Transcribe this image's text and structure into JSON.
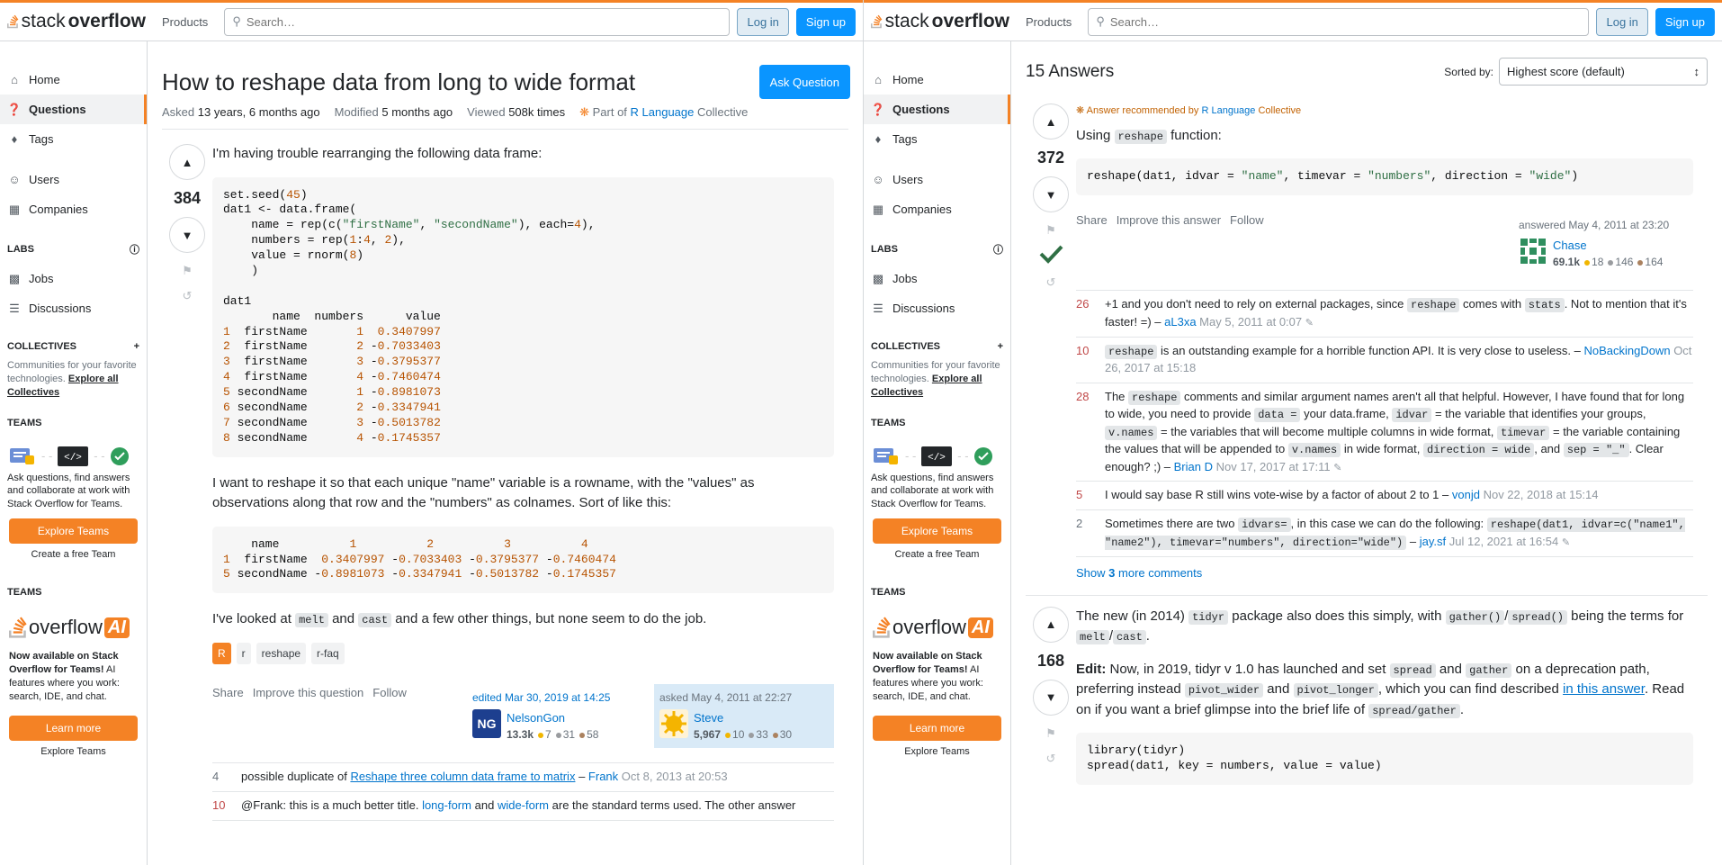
{
  "header": {
    "logo_text": [
      "stack",
      "overflow"
    ],
    "products": "Products",
    "search_placeholder": "Search…",
    "login": "Log in",
    "signup": "Sign up"
  },
  "nav": {
    "home": "Home",
    "questions": "Questions",
    "tags": "Tags",
    "users": "Users",
    "companies": "Companies",
    "labs": "LABS",
    "jobs": "Jobs",
    "discussions": "Discussions",
    "collectives": "COLLECTIVES",
    "collectives_text": "Communities for your favorite technologies.",
    "explore_all": "Explore all Collectives",
    "teams": "TEAMS",
    "teams_text": "Ask questions, find answers and collaborate at work with Stack Overflow for Teams.",
    "explore_teams": "Explore Teams",
    "create_team": "Create a free Team",
    "teams2": "TEAMS",
    "overflow_word": "overflow",
    "ai_badge": "AI",
    "oai_bold": "Now available on Stack Overflow for Teams!",
    "oai_text": " AI features where you work: search, IDE, and chat.",
    "learn_more": "Learn more",
    "explore_teams2": "Explore Teams"
  },
  "question": {
    "title": "How to reshape data from long to wide format",
    "ask_button": "Ask Question",
    "asked_label": "Asked",
    "asked_value": "13 years, 6 months ago",
    "modified_label": "Modified",
    "modified_value": "5 months ago",
    "viewed_label": "Viewed",
    "viewed_value": "508k times",
    "collective_prefix": "Part of",
    "collective_name": "R Language",
    "collective_suffix": "Collective",
    "score": "384",
    "p1": "I'm having trouble rearranging the following data frame:",
    "p2": "I want to reshape it so that each unique \"name\" variable is a rowname, with the \"values\" as observations along that row and the \"numbers\" as colnames. Sort of like this:",
    "p3a": "I've looked at",
    "p3_code1": "melt",
    "p3b": "and",
    "p3_code2": "cast",
    "p3c": "and a few other things, but none seem to do the job.",
    "tags": [
      "r",
      "reshape",
      "r-faq"
    ],
    "tag_badge": "R",
    "actions": [
      "Share",
      "Improve this question",
      "Follow"
    ],
    "edited": "edited Mar 30, 2019 at 14:25",
    "editor": {
      "name": "NelsonGon",
      "rep": "13.3k",
      "gold": "7",
      "silver": "31",
      "bronze": "58"
    },
    "asked": "asked May 4, 2011 at 22:27",
    "asker": {
      "name": "Steve",
      "rep": "5,967",
      "gold": "10",
      "silver": "33",
      "bronze": "30"
    },
    "comments": [
      {
        "score": "4",
        "pre": "possible duplicate of",
        "link": "Reshape three column data frame to matrix",
        "user": "Frank",
        "date": "Oct 8, 2013 at 20:53"
      },
      {
        "score": "10",
        "pre": "@Frank: this is a much better title.",
        "link": "long-form",
        "mid": "and",
        "link2": "wide-form",
        "post": "are the standard terms used. The other answer"
      }
    ]
  },
  "answers": {
    "count": "15 Answers",
    "sort_label": "Sorted by:",
    "sort_value": "Highest score (default)",
    "a1": {
      "recommended_prefix": "Answer recommended by",
      "recommended_collective": "R Language",
      "recommended_suffix": "Collective",
      "score": "372",
      "using": "Using",
      "using_code": "reshape",
      "using_suffix": "function:",
      "actions": [
        "Share",
        "Improve this answer",
        "Follow"
      ],
      "answered": "answered May 4, 2011 at 23:20",
      "user": {
        "name": "Chase",
        "rep": "69.1k",
        "gold": "18",
        "silver": "146",
        "bronze": "164"
      },
      "comments": [
        {
          "score": "26",
          "date": "May 5, 2011 at 0:07",
          "user": "aL3xa"
        },
        {
          "score": "10",
          "user": "NoBackingDown",
          "date": "Oct 26, 2017 at 15:18"
        },
        {
          "score": "28",
          "user": "Brian D",
          "date": "Nov 17, 2017 at 17:11"
        },
        {
          "score": "5",
          "text": "I would say base R still wins vote-wise by a factor of about 2 to 1 –",
          "user": "vonjd",
          "date": "Nov 22, 2018 at 15:14"
        },
        {
          "score": "2",
          "user": "jay.sf",
          "date": "Jul 12, 2021 at 16:54"
        }
      ],
      "show_more_a": "Show",
      "show_more_n": "3",
      "show_more_b": "more comments"
    },
    "a2": {
      "score": "168",
      "link": "in this answer"
    }
  }
}
